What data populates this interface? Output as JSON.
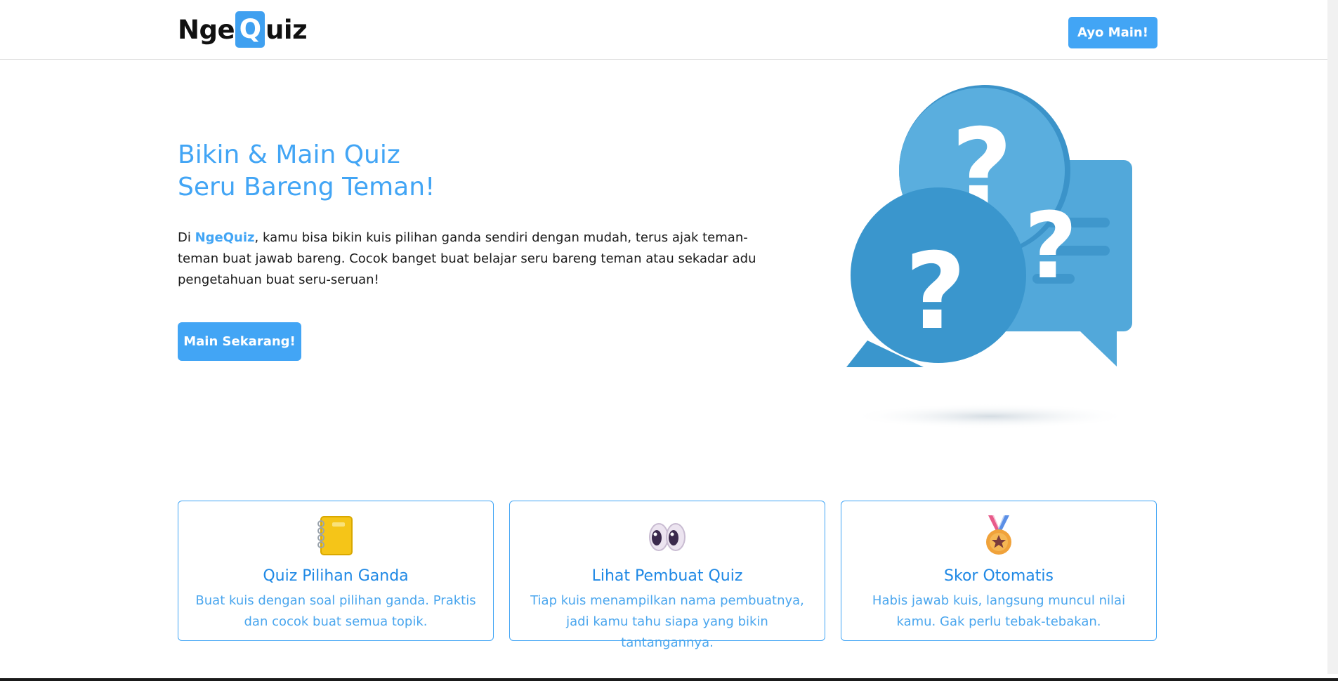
{
  "navbar": {
    "logo_prefix": "Nge",
    "logo_letter": "Q",
    "logo_suffix": "uiz",
    "cta_label": "Ayo Main!"
  },
  "hero": {
    "title_line1": "Bikin & Main Quiz",
    "title_line2": "Seru Bareng Teman!",
    "desc_prefix": "Di ",
    "desc_brand": "NgeQuiz",
    "desc_rest": ", kamu bisa bikin kuis pilihan ganda sendiri dengan mudah, terus ajak teman-teman buat jawab bareng. Cocok banget buat belajar seru bareng teman atau sekadar adu pengetahuan buat seru-seruan!",
    "cta_label": "Main Sekarang!",
    "illustration_icon": "question-bubbles-icon"
  },
  "features": [
    {
      "icon": "notebook-icon",
      "title": "Quiz Pilihan Ganda",
      "desc": "Buat kuis dengan soal pilihan ganda. Praktis dan cocok buat semua topik."
    },
    {
      "icon": "eyes-icon",
      "title": "Lihat Pembuat Quiz",
      "desc": "Tiap kuis menampilkan nama pembuatnya, jadi kamu tahu siapa yang bikin tantangannya."
    },
    {
      "icon": "medal-icon",
      "title": "Skor Otomatis",
      "desc": "Habis jawab kuis, langsung muncul nilai kamu. Gak perlu tebak-tebakan."
    }
  ],
  "colors": {
    "accent": "#42a5f5",
    "card_title": "#1e88e5",
    "card_text": "#4aa6ee"
  }
}
